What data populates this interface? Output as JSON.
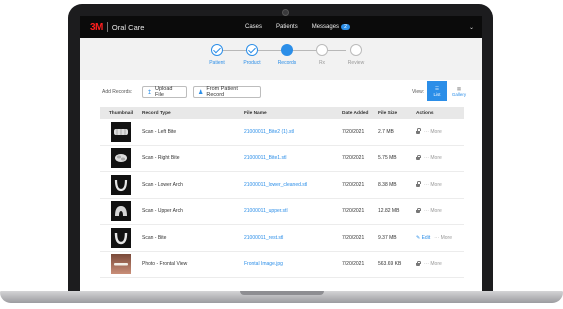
{
  "app": {
    "logo": "3M",
    "name": "Oral Care"
  },
  "nav": {
    "cases": "Cases",
    "patients": "Patients",
    "messages": "Messages",
    "messages_count": "2"
  },
  "steps": [
    {
      "label": "Patient",
      "state": "done"
    },
    {
      "label": "Product",
      "state": "done"
    },
    {
      "label": "Records",
      "state": "active"
    },
    {
      "label": "Rx",
      "state": "todo"
    },
    {
      "label": "Review",
      "state": "todo"
    }
  ],
  "toolbar": {
    "add_records_label": "Add Records:",
    "upload_file": "Upload File",
    "from_patient_record": "From Patient Record",
    "view_label": "View:",
    "list": "List",
    "gallery": "Gallery"
  },
  "table": {
    "headers": [
      "Thumbnail",
      "Record Type",
      "File Name",
      "Date Added",
      "File Size",
      "Actions"
    ],
    "rows": [
      {
        "type": "Scan - Left Bite",
        "file": "21000011_Bite2 (1).stl",
        "date": "7/20/2021",
        "size": "2.7 MB",
        "action": "More"
      },
      {
        "type": "Scan - Right Bite",
        "file": "21000011_Bite1.stl",
        "date": "7/20/2021",
        "size": "5.75 MB",
        "action": "More"
      },
      {
        "type": "Scan - Lower Arch",
        "file": "21000011_lower_cleaned.stl",
        "date": "7/20/2021",
        "size": "8.38 MB",
        "action": "More"
      },
      {
        "type": "Scan - Upper Arch",
        "file": "21000011_upper.stl",
        "date": "7/20/2021",
        "size": "12.82 MB",
        "action": "More"
      },
      {
        "type": "Scan - Bite",
        "file": "21000011_rest.stl",
        "date": "7/20/2021",
        "size": "9.37 MB",
        "edit": "Edit",
        "action": "More"
      },
      {
        "type": "Photo - Frontal View",
        "file": "Frontal Image.jpg",
        "date": "7/20/2021",
        "size": "563.69 KB",
        "action": "More"
      }
    ]
  },
  "colors": {
    "accent": "#2b8ee8",
    "brand": "#ff1e1e",
    "topbar": "#0b0b0b"
  }
}
